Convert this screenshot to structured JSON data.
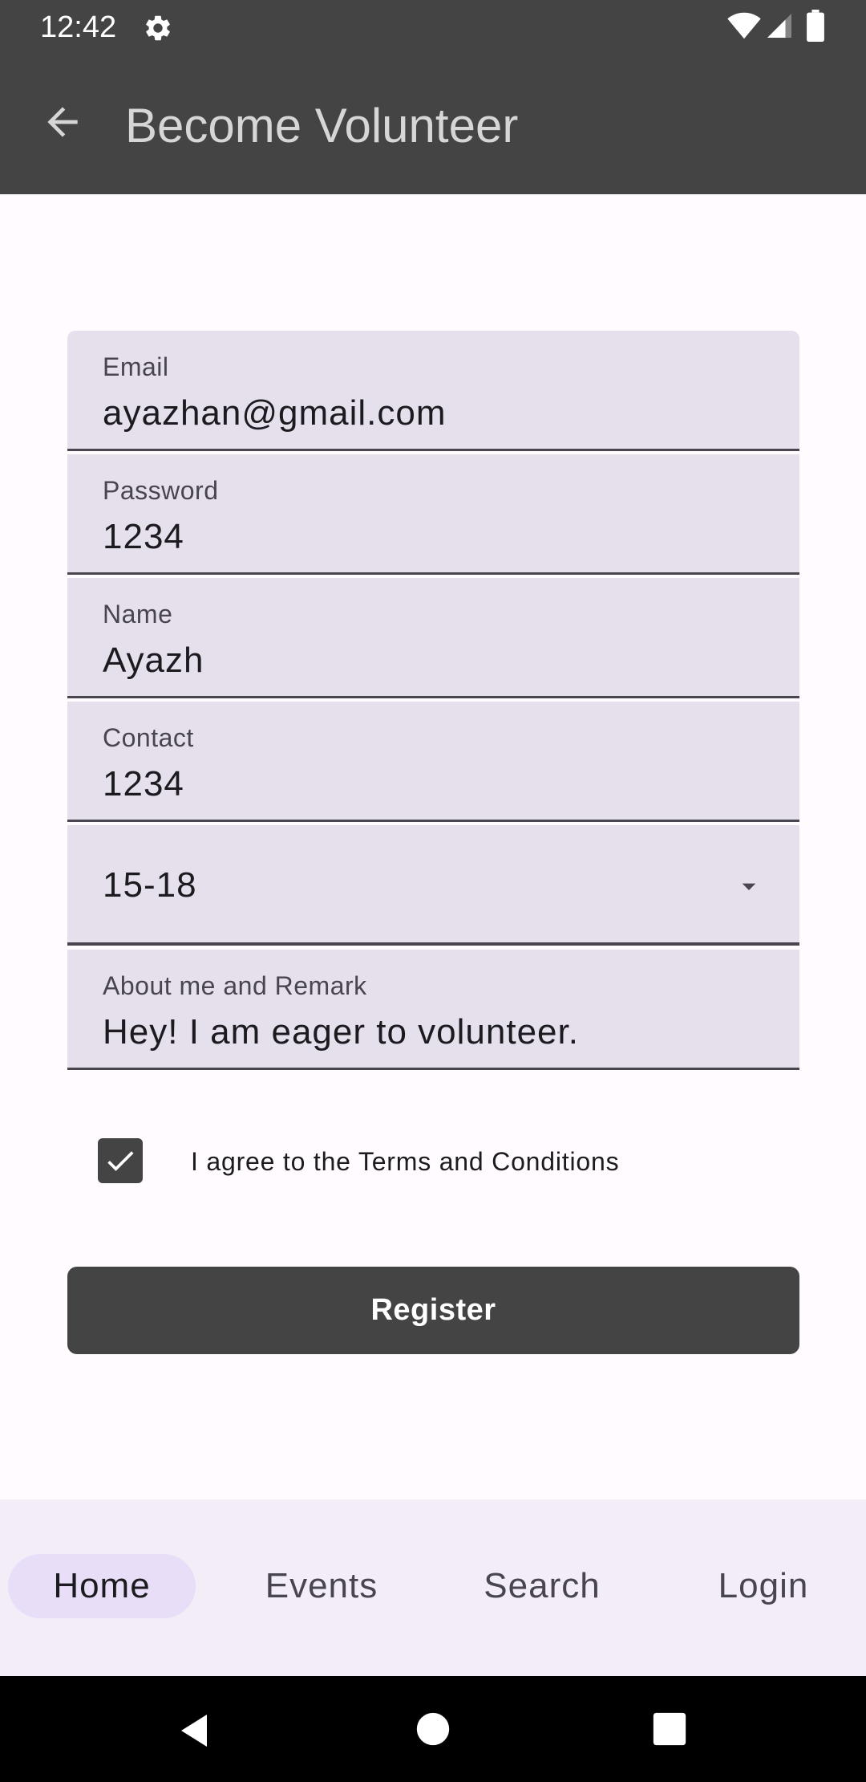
{
  "status_bar": {
    "time": "12:42",
    "icons": [
      "gear-icon",
      "wifi-icon",
      "signal-icon",
      "battery-icon"
    ]
  },
  "app_bar": {
    "title": "Become Volunteer",
    "back_icon": "arrow-back-icon"
  },
  "form": {
    "email": {
      "label": "Email",
      "value": "ayazhan@gmail.com"
    },
    "password": {
      "label": "Password",
      "value": "1234"
    },
    "name": {
      "label": "Name",
      "value": "Ayazh"
    },
    "contact": {
      "label": "Contact",
      "value": "1234"
    },
    "age_group": {
      "selected": "15-18",
      "icon": "dropdown-arrow-icon"
    },
    "about": {
      "label": "About me and Remark",
      "value": "Hey! I am eager to volunteer."
    },
    "terms": {
      "label": "I agree to the Terms and Conditions",
      "checked": true
    },
    "register_label": "Register"
  },
  "bottom_nav": {
    "items": [
      {
        "label": "Home",
        "active": true
      },
      {
        "label": "Events",
        "active": false
      },
      {
        "label": "Search",
        "active": false
      },
      {
        "label": "Login",
        "active": false
      }
    ]
  },
  "colors": {
    "primary": "#444444",
    "field_background": "#E6E0EC",
    "active_nav_indicator": "#E8DEF8",
    "nav_background": "#F3EDF7"
  }
}
